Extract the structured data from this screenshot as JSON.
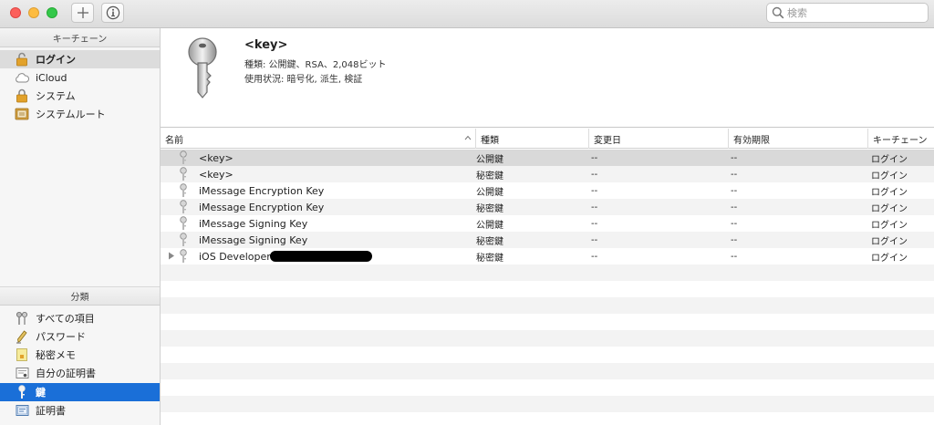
{
  "toolbar": {
    "add_icon": "plus-icon",
    "info_icon": "info-icon",
    "search_placeholder": "検索"
  },
  "sidebar": {
    "keychain_header": "キーチェーン",
    "keychains": [
      {
        "label": "ログイン",
        "icon": "lock-open-icon",
        "selected": true
      },
      {
        "label": "iCloud",
        "icon": "cloud-icon",
        "selected": false
      },
      {
        "label": "システム",
        "icon": "lock-icon",
        "selected": false
      },
      {
        "label": "システムルート",
        "icon": "cabinet-icon",
        "selected": false
      }
    ],
    "category_header": "分類",
    "categories": [
      {
        "label": "すべての項目",
        "icon": "all-items-icon",
        "selected": false
      },
      {
        "label": "パスワード",
        "icon": "pen-icon",
        "selected": false
      },
      {
        "label": "秘密メモ",
        "icon": "note-icon",
        "selected": false
      },
      {
        "label": "自分の証明書",
        "icon": "my-certificate-icon",
        "selected": false
      },
      {
        "label": "鍵",
        "icon": "key-icon",
        "selected": true
      },
      {
        "label": "証明書",
        "icon": "certificate-icon",
        "selected": false
      }
    ]
  },
  "detail": {
    "title": "<key>",
    "line1": "種類: 公開鍵、RSA、2,048ビット",
    "line2": "使用状況: 暗号化, 派生, 検証"
  },
  "table": {
    "columns": [
      "名前",
      "種類",
      "変更日",
      "有効期限",
      "キーチェーン"
    ],
    "rows": [
      {
        "name": "<key>",
        "kind": "公開鍵",
        "modified": "--",
        "expires": "--",
        "keychain": "ログイン",
        "selected": true
      },
      {
        "name": "<key>",
        "kind": "秘密鍵",
        "modified": "--",
        "expires": "--",
        "keychain": "ログイン"
      },
      {
        "name": "iMessage Encryption Key",
        "kind": "公開鍵",
        "modified": "--",
        "expires": "--",
        "keychain": "ログイン"
      },
      {
        "name": "iMessage Encryption Key",
        "kind": "秘密鍵",
        "modified": "--",
        "expires": "--",
        "keychain": "ログイン"
      },
      {
        "name": "iMessage Signing Key",
        "kind": "公開鍵",
        "modified": "--",
        "expires": "--",
        "keychain": "ログイン"
      },
      {
        "name": "iMessage Signing Key",
        "kind": "秘密鍵",
        "modified": "--",
        "expires": "--",
        "keychain": "ログイン"
      },
      {
        "name": "iOS Developer:",
        "kind": "秘密鍵",
        "modified": "--",
        "expires": "--",
        "keychain": "ログイン",
        "expandable": true,
        "redacted": true
      }
    ]
  }
}
